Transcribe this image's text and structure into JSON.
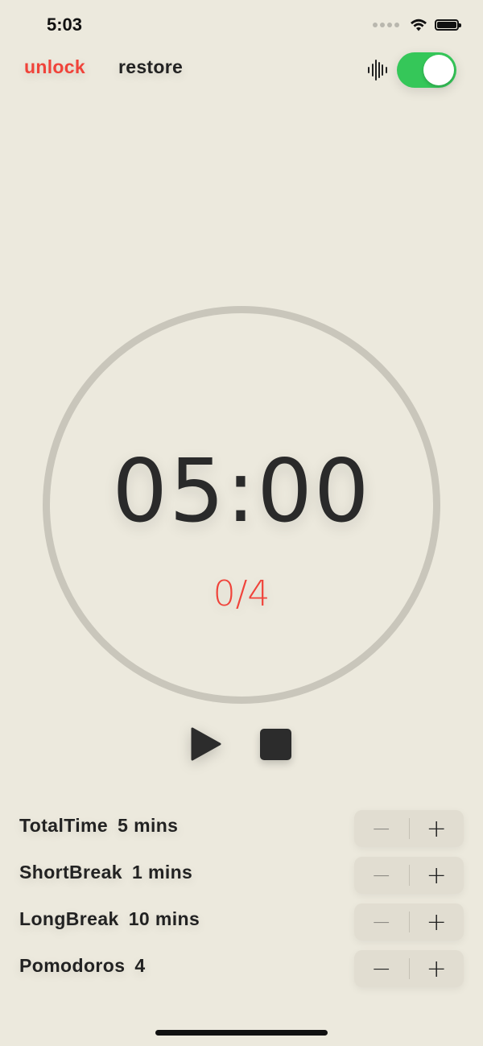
{
  "status_bar": {
    "time": "5:03"
  },
  "header": {
    "unlock_label": "unlock",
    "restore_label": "restore",
    "sound_toggle_on": true
  },
  "timer": {
    "time": "05:00",
    "rounds": "0/4"
  },
  "settings": {
    "total_time": {
      "label": "TotalTime",
      "value": "5 mins",
      "minus": "−",
      "plus": "+"
    },
    "short_break": {
      "label": "ShortBreak",
      "value": "1 mins",
      "minus": "−",
      "plus": "+"
    },
    "long_break": {
      "label": "LongBreak",
      "value": "10 mins",
      "minus": "−",
      "plus": "+"
    },
    "pomodoros": {
      "label": "Pomodoros",
      "value": "4",
      "minus": "−",
      "plus": "+"
    }
  },
  "colors": {
    "background": "#ece9dd",
    "accent_red": "#f0433a",
    "toggle_green": "#35c759",
    "ring": "#c9c6bb"
  },
  "icons": {
    "sound": "waveform-icon",
    "play": "play-icon",
    "stop": "stop-icon"
  }
}
